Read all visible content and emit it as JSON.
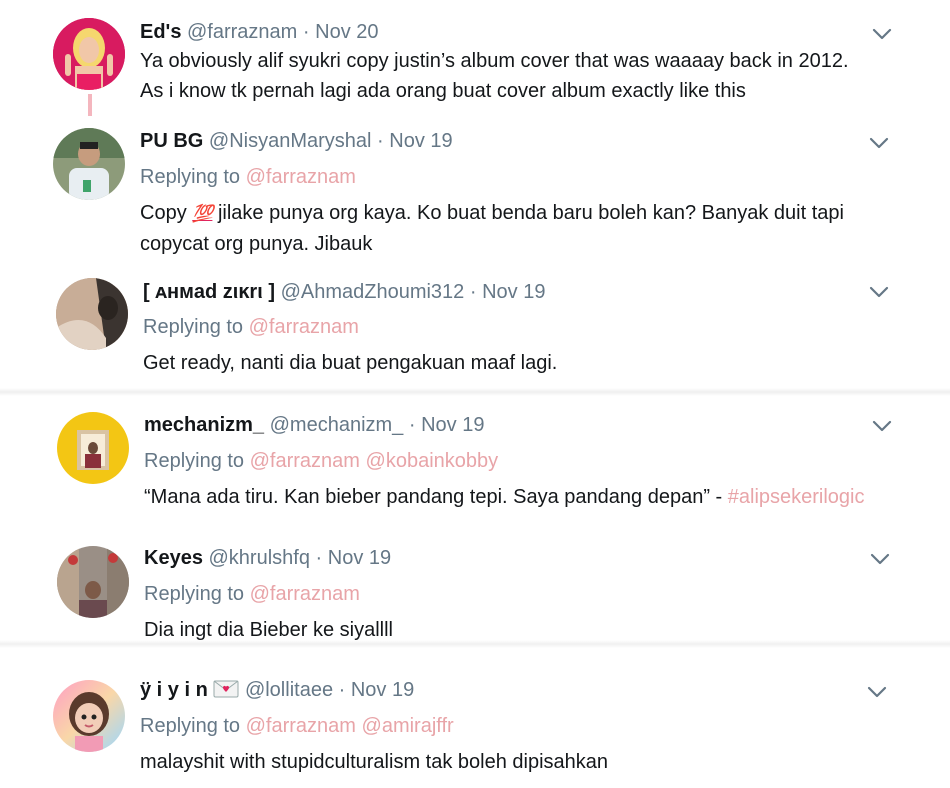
{
  "tweets": [
    {
      "name": "Ed's",
      "handle": "@farraznam",
      "dot": "·",
      "date": "Nov 20",
      "text_lines": [
        "Ya obviously alif syukri copy justin’s album cover that was waaaay back in 2012.",
        "As i know tk pernah lagi ada orang buat cover album exactly like this"
      ]
    },
    {
      "name": "PU BG",
      "handle": "@NisyanMaryshal",
      "dot": "·",
      "date": "Nov 19",
      "replying_label": "Replying to",
      "mentions": [
        "@farraznam"
      ],
      "text_pre_emoji": "Copy ",
      "emoji": "💯",
      "text_post_emoji": " jilake punya org kaya. Ko buat benda baru boleh kan? Banyak duit tapi",
      "text_line2": "copycat org punya. Jibauk"
    },
    {
      "name": "[ ᴀнмad zιĸrι ]",
      "handle": "@AhmadZhoumi312",
      "dot": "·",
      "date": "Nov 19",
      "replying_label": "Replying to",
      "mentions": [
        "@farraznam"
      ],
      "text": "Get ready, nanti dia buat pengakuan maaf lagi."
    },
    {
      "name": "mechanizm_",
      "handle": "@mechanizm_",
      "dot": "·",
      "date": "Nov 19",
      "replying_label": "Replying to",
      "mentions": [
        "@farraznam",
        "@kobainkobby"
      ],
      "text": "“Mana ada tiru. Kan bieber pandang tepi. Saya pandang depan” - ",
      "hashtag": "#alipsekerilogic"
    },
    {
      "name": "Keyes",
      "handle": "@khrulshfq",
      "dot": "·",
      "date": "Nov 19",
      "replying_label": "Replying to",
      "mentions": [
        "@farraznam"
      ],
      "text": "Dia ingt dia Bieber ke siyallll"
    },
    {
      "name": "ÿ i y i n",
      "name_emoji": "💌",
      "handle": "@lollitaee",
      "dot": "·",
      "date": "Nov 19",
      "replying_label": "Replying to",
      "mentions": [
        "@farraznam",
        "@amirajffr"
      ],
      "text": "malayshit with stupidculturalism tak boleh dipisahkan"
    }
  ],
  "icons": {
    "more": "chevron-down-icon"
  },
  "colors": {
    "mention": "#e8a4a8",
    "thread_line": "#f4b6be",
    "secondary_text": "#657786"
  }
}
